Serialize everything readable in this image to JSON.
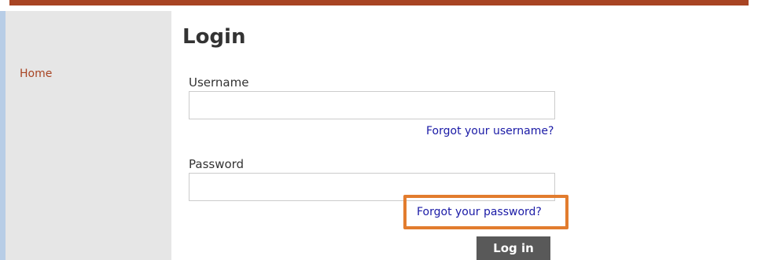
{
  "colors": {
    "accent": "#a84423",
    "link": "#1a1aa6",
    "highlight": "#e27c2e",
    "sidebar_bg": "#e6e6e6",
    "button_bg": "#595959"
  },
  "sidebar": {
    "items": [
      {
        "label": "Home"
      }
    ]
  },
  "main": {
    "title": "Login",
    "username": {
      "label": "Username",
      "value": "",
      "placeholder": ""
    },
    "forgot_username": "Forgot your username?",
    "password": {
      "label": "Password",
      "value": "",
      "placeholder": ""
    },
    "forgot_password": "Forgot your password?",
    "login_button": "Log in"
  }
}
